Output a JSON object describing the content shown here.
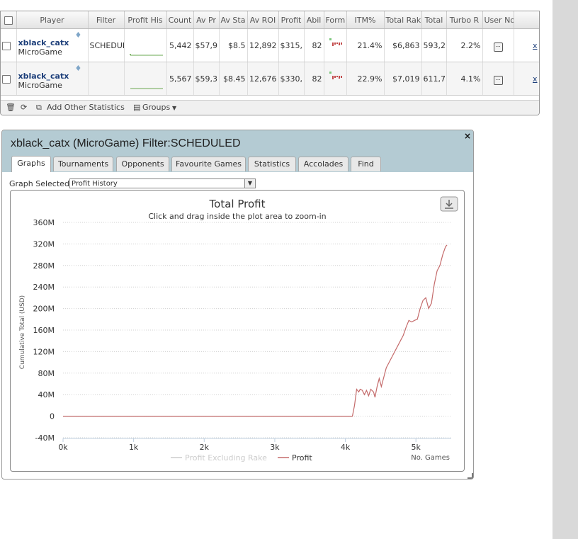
{
  "grid": {
    "columns": [
      "Player",
      "Filter",
      "Profit His",
      "Count",
      "Av Pr",
      "Av Sta",
      "Av ROI",
      "Profit",
      "Abil",
      "Form",
      "ITM%",
      "Total Rak",
      "Total",
      "Turbo R",
      "User No"
    ],
    "rows": [
      {
        "player": "xblack_catx",
        "network": "MicroGame",
        "filter": "SCHEDULED",
        "count": "5,442",
        "av_prize": "$57,9",
        "av_stake": "$8.5",
        "av_roi": "12,892",
        "profit": "$315,",
        "ability": "82",
        "itm": "21.4%",
        "total_rake": "$6,863",
        "total": "593,2",
        "turbo": "2.2%",
        "notes": "...",
        "link": "x"
      },
      {
        "player": "xblack_catx",
        "network": "MicroGame",
        "filter": "",
        "count": "5,567",
        "av_prize": "$59,3",
        "av_stake": "$8.45",
        "av_roi": "12,676",
        "profit": "$330,",
        "ability": "82",
        "itm": "22.9%",
        "total_rake": "$7,019",
        "total": "611,7",
        "turbo": "4.1%",
        "notes": "...",
        "link": "x"
      }
    ],
    "footer": {
      "add_stats": "Add Other Statistics",
      "groups": "Groups"
    }
  },
  "window": {
    "title": "xblack_catx (MicroGame) Filter:SCHEDULED",
    "close": "×",
    "tabs": [
      "Graphs",
      "Tournaments",
      "Opponents",
      "Favourite Games",
      "Statistics",
      "Accolades",
      "Find"
    ],
    "active_tab": "Graphs",
    "graph_selected_label": "Graph Selected:",
    "graph_selected_value": "Profit History"
  },
  "chart_data": {
    "type": "line",
    "title": "Total Profit",
    "subtitle": "Click and drag inside the plot area to zoom-in",
    "ylabel": "Cumulative Total (USD)",
    "xlabel": "No. Games",
    "ylim": [
      -40,
      360
    ],
    "xlim": [
      0,
      5500
    ],
    "y_ticks": [
      "-40M",
      "0",
      "40M",
      "80M",
      "120M",
      "160M",
      "200M",
      "240M",
      "280M",
      "320M",
      "360M"
    ],
    "y_tick_values": [
      -40,
      0,
      40,
      80,
      120,
      160,
      200,
      240,
      280,
      320,
      360
    ],
    "x_ticks": [
      "0k",
      "1k",
      "2k",
      "3k",
      "4k",
      "5k"
    ],
    "x_tick_values": [
      0,
      1000,
      2000,
      3000,
      4000,
      5000
    ],
    "legend": [
      "Profit Excluding Rake",
      "Profit"
    ],
    "series": [
      {
        "name": "Profit Excluding Rake",
        "color": "#cccccc",
        "x": [
          0,
          4100
        ],
        "y": [
          0,
          0
        ]
      },
      {
        "name": "Profit",
        "color": "#c46a6a",
        "x": [
          0,
          4100,
          4130,
          4160,
          4190,
          4210,
          4240,
          4270,
          4300,
          4330,
          4360,
          4400,
          4420,
          4450,
          4480,
          4510,
          4550,
          4580,
          4620,
          4660,
          4700,
          4740,
          4780,
          4820,
          4860,
          4900,
          4940,
          4980,
          5020,
          5060,
          5100,
          5140,
          5180,
          5220,
          5260,
          5300,
          5340,
          5380,
          5420,
          5440
        ],
        "y": [
          0,
          0,
          20,
          50,
          45,
          50,
          48,
          40,
          48,
          38,
          50,
          45,
          35,
          55,
          70,
          55,
          75,
          90,
          100,
          110,
          120,
          130,
          140,
          150,
          165,
          178,
          175,
          178,
          180,
          200,
          215,
          220,
          200,
          210,
          245,
          270,
          280,
          300,
          315,
          318
        ]
      }
    ]
  },
  "colors": {
    "header_bg": "#b4cbd3",
    "link": "#1d3f7a",
    "profit_line": "#c46a6a",
    "gridline": "#d0d0d0"
  }
}
